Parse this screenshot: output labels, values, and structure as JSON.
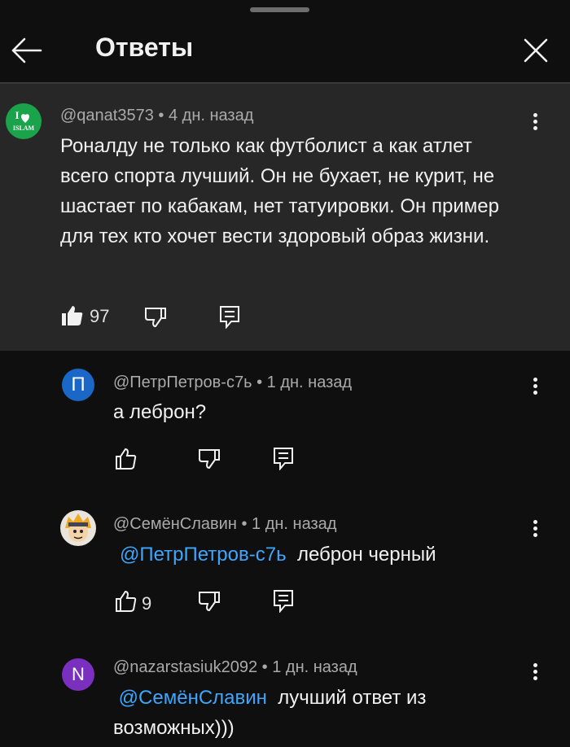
{
  "header": {
    "title": "Ответы",
    "icons": {
      "back": "arrow-left-icon",
      "close": "close-x-icon"
    }
  },
  "comments": [
    {
      "author": "@qanat3573",
      "time": "4 дн. назад",
      "avatar": {
        "line1": "I",
        "line2": "ISLAM",
        "color": "#1aa34a"
      },
      "text": "Роналду не только как футболист а как атлет всего спорта лучший. Он не бухает, не курит, не шастает по кабакам, нет татуировки. Он пример для тех кто хочет вести здоровый образ жизни.",
      "likes": "97"
    },
    {
      "author": "@ПетрПетров-с7ь",
      "time": "1 дн. назад",
      "avatar": {
        "letter": "П",
        "color": "#1a67c7"
      },
      "text": "а леброн?",
      "likes": ""
    },
    {
      "author": "@СемёнСлавин",
      "time": "1 дн. назад",
      "avatar": {
        "type": "cartoon"
      },
      "mention": "@ПетрПетров-с7ь",
      "text": "леброн черный",
      "likes": "9"
    },
    {
      "author": "@nazarstasiuk2092",
      "time": "1 дн. назад",
      "avatar": {
        "letter": "N",
        "color": "#7b2fbe"
      },
      "mention": "@СемёнСлавин",
      "text": "лучший ответ из возможных)))"
    }
  ],
  "dot": "•"
}
